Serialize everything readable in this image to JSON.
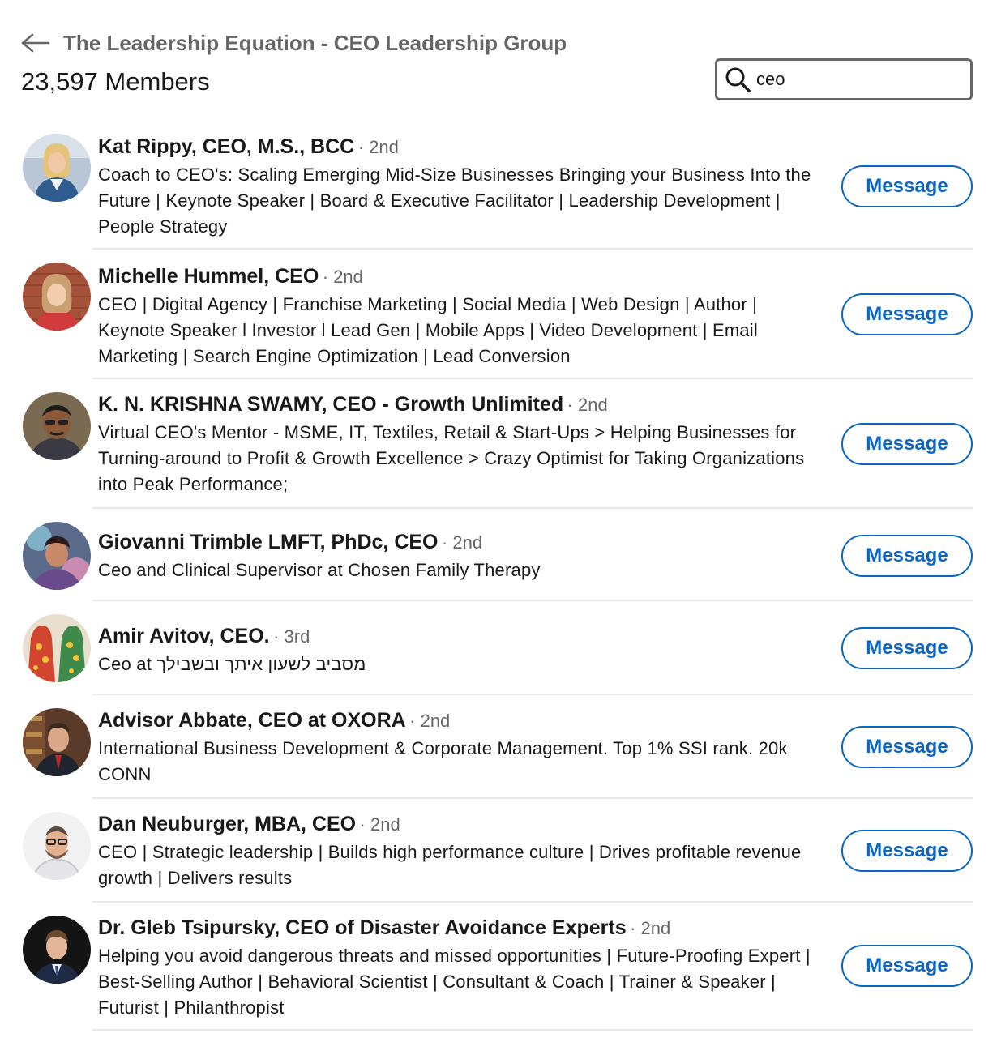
{
  "header": {
    "group_title": "The Leadership Equation - CEO Leadership Group",
    "member_count": "23,597 Members",
    "back_icon": "arrow-left-icon"
  },
  "search": {
    "value": "ceo",
    "icon": "search-icon"
  },
  "colors": {
    "accent": "#0a66c2",
    "text_primary": "#191919",
    "text_secondary": "#666666",
    "divider": "#e8e8e8"
  },
  "members": [
    {
      "name": "Kat Rippy, CEO, M.S., BCC",
      "degree": "· 2nd",
      "headline": "Coach to CEO's: Scaling Emerging Mid-Size Businesses Bringing your Business Into the Future | Keynote Speaker | Board & Executive Facilitator | Leadership Development | People Strategy",
      "button_label": "Message",
      "avatar_icon": "profile-photo"
    },
    {
      "name": "Michelle Hummel, CEO",
      "degree": "· 2nd",
      "headline": "CEO | Digital Agency | Franchise Marketing | Social Media | Web Design | Author | Keynote Speaker l Investor l Lead Gen | Mobile Apps | Video Development | Email Marketing | Search Engine Optimization | Lead Conversion",
      "button_label": "Message",
      "avatar_icon": "profile-photo"
    },
    {
      "name": "K. N. KRISHNA SWAMY, CEO - Growth Unlimited",
      "degree": "· 2nd",
      "headline": "Virtual CEO's Mentor - MSME, IT, Textiles, Retail & Start-Ups > Helping Businesses for Turning-around to Profit & Growth Excellence > Crazy Optimist for Taking Organizations into Peak Performance;",
      "button_label": "Message",
      "avatar_icon": "profile-photo"
    },
    {
      "name": "Giovanni Trimble LMFT, PhDc, CEO",
      "degree": "· 2nd",
      "headline": "Ceo and Clinical Supervisor at Chosen Family Therapy",
      "button_label": "Message",
      "avatar_icon": "profile-photo"
    },
    {
      "name": "Amir Avitov, CEO.",
      "degree": "· 3rd",
      "headline": "Ceo at מסביב לשעון איתך ובשבילך",
      "button_label": "Message",
      "avatar_icon": "profile-photo"
    },
    {
      "name": "Advisor Abbate, CEO at OXORA",
      "degree": "· 2nd",
      "headline": "International Business Development & Corporate Management. Top 1% SSI rank. 20k CONN",
      "button_label": "Message",
      "avatar_icon": "profile-photo"
    },
    {
      "name": "Dan Neuburger, MBA, CEO",
      "degree": "· 2nd",
      "headline": "CEO | Strategic leadership | Builds high performance culture | Drives profitable revenue growth | Delivers results",
      "button_label": "Message",
      "avatar_icon": "profile-photo"
    },
    {
      "name": "Dr. Gleb Tsipursky, CEO of Disaster Avoidance Experts",
      "degree": "· 2nd",
      "headline": "Helping you avoid dangerous threats and missed opportunities | Future-Proofing Expert | Best-Selling Author | Behavioral Scientist | Consultant & Coach | Trainer & Speaker | Futurist | Philanthropist",
      "button_label": "Message",
      "avatar_icon": "profile-photo"
    }
  ]
}
